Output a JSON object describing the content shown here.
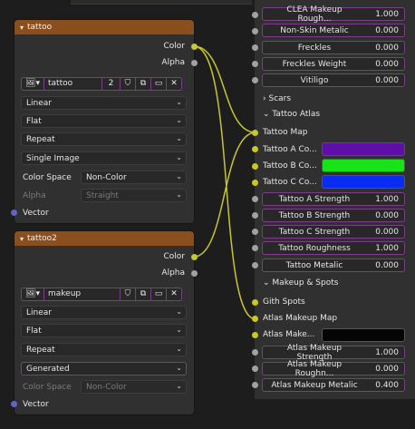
{
  "colors": {
    "wire": "#c7c729",
    "header": "#8a4f1d",
    "tattoo_a": "#5d0fa6",
    "tattoo_b": "#18e318",
    "tattoo_c": "#0a2bf2",
    "atlas_makeup": "#050505"
  },
  "node1": {
    "title": "tattoo",
    "outputs": {
      "color": "Color",
      "alpha": "Alpha"
    },
    "image": {
      "name": "tattoo",
      "users": "2"
    },
    "interpolation": "Linear",
    "projection": "Flat",
    "extension": "Repeat",
    "source": "Single Image",
    "color_space_label": "Color Space",
    "color_space": "Non-Color",
    "alpha_label": "Alpha",
    "alpha": "Straight",
    "vector_label": "Vector"
  },
  "node2": {
    "title": "tattoo2",
    "outputs": {
      "color": "Color",
      "alpha": "Alpha"
    },
    "image": {
      "name": "makeup"
    },
    "interpolation": "Linear",
    "projection": "Flat",
    "extension": "Repeat",
    "source": "Generated",
    "color_space_label": "Color Space",
    "color_space": "Non-Color",
    "vector_label": "Vector"
  },
  "right": {
    "top_props": [
      {
        "name": "CLEA Makeup Rough...",
        "value": "1.000"
      },
      {
        "name": "Non-Skin Metalic",
        "value": "0.000"
      },
      {
        "name": "Freckles",
        "value": "0.000"
      },
      {
        "name": "Freckles Weight",
        "value": "0.000"
      },
      {
        "name": "Vitiligo",
        "value": "0.000"
      }
    ],
    "scars": "Scars",
    "tattoo_atlas": "Tattoo Atlas",
    "tattoo_map": "Tattoo Map",
    "tattoo_a": "Tattoo A Co...",
    "tattoo_b": "Tattoo B Co...",
    "tattoo_c": "Tattoo C Co...",
    "tattoo_props": [
      {
        "name": "Tattoo A Strength",
        "value": "1.000"
      },
      {
        "name": "Tattoo B Strength",
        "value": "0.000"
      },
      {
        "name": "Tattoo C Strength",
        "value": "0.000"
      },
      {
        "name": "Tattoo Roughness",
        "value": "1.000"
      },
      {
        "name": "Tattoo Metalic",
        "value": "0.000"
      }
    ],
    "makeup_spots": "Makeup & Spots",
    "gith_spots": "Gith Spots",
    "atlas_makeup_map": "Atlas Makeup Map",
    "atlas_makeup": "Atlas Make...",
    "atlas_props": [
      {
        "name": "Atlas Makeup Strength",
        "value": "1.000"
      },
      {
        "name": "Atlas Makeup Roughn...",
        "value": "0.000"
      },
      {
        "name": "Atlas Makeup Metalic",
        "value": "0.400"
      }
    ]
  }
}
